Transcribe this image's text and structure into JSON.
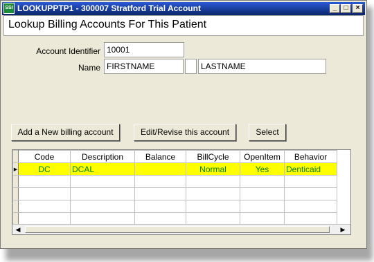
{
  "window": {
    "title": "LOOKUPPTP1 - 300007 Stratford Trial Account",
    "app_icon_text": "SSI",
    "minimize_glyph": "_",
    "maximize_glyph": "□",
    "close_glyph": "×"
  },
  "header": {
    "title": "Lookup Billing Accounts For This Patient"
  },
  "form": {
    "account_identifier_label": "Account Identifier",
    "account_identifier_value": "10001",
    "name_label": "Name",
    "first_name": "FIRSTNAME",
    "middle_name": "",
    "last_name": "LASTNAME"
  },
  "buttons": {
    "add": "Add a New billing account",
    "edit": "Edit/Revise this account",
    "select": "Select"
  },
  "grid": {
    "columns": [
      "Code",
      "Description",
      "Balance",
      "BillCycle",
      "OpenItem",
      "Behavior"
    ],
    "rows": [
      {
        "indicator": "▶",
        "code": "DC",
        "description": "DCAL",
        "balance": "",
        "billcycle": "Normal",
        "openitem": "Yes",
        "behavior": "Denticaid"
      }
    ],
    "selected_row_color": "#ffff00",
    "selected_text_color": "#008000"
  },
  "scrollbar": {
    "left_arrow": "◀",
    "right_arrow": "▶"
  }
}
